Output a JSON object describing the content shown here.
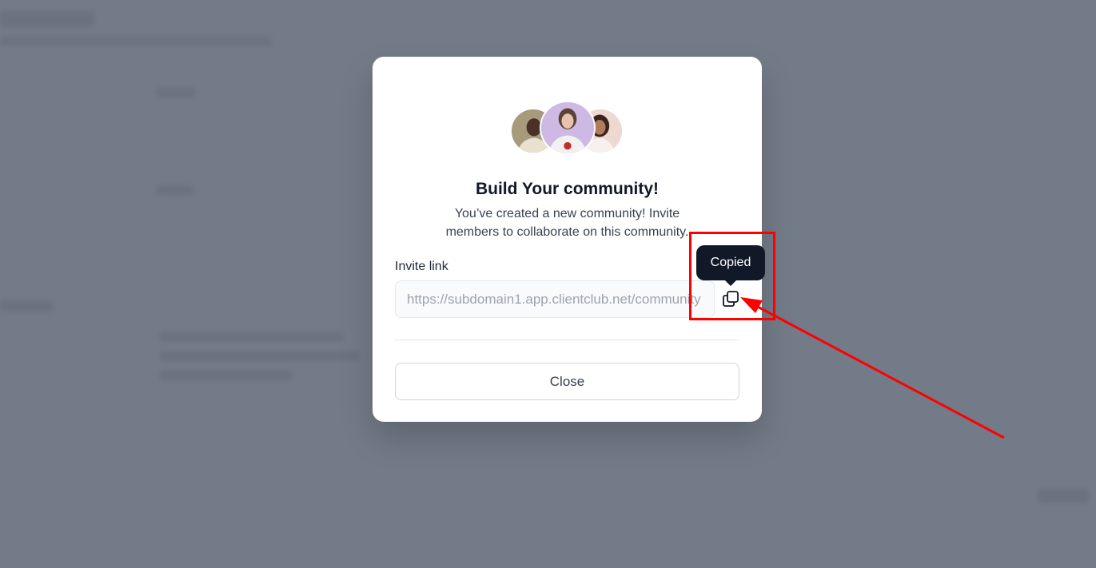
{
  "modal": {
    "title": "Build Your community!",
    "subtitle": "You’ve created a new community! Invite members to collaborate on this community.",
    "invite_label": "Invite link",
    "invite_link_value": "https://subdomain1.app.clientclub.net/community",
    "tooltip_text": "Copied",
    "close_label": "Close",
    "copy_icon": "copy-icon"
  },
  "annotation": {
    "color": "#ff0000"
  }
}
